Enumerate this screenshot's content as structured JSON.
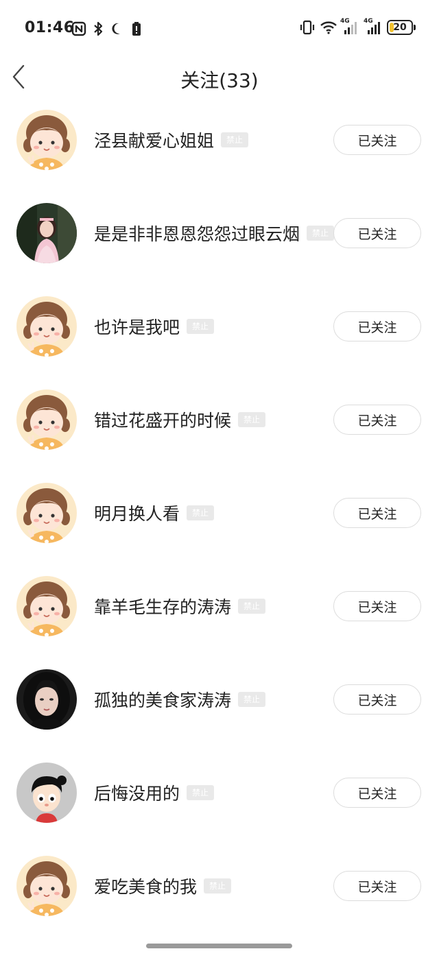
{
  "status_bar": {
    "time": "01:46",
    "battery": "20",
    "net_label_1": "4G",
    "net_label_2": "4G",
    "battery_level": 0.2,
    "left_icons": [
      "nfc-icon",
      "bluetooth-icon",
      "moon-icon",
      "battery-saver-icon"
    ],
    "right_icons": [
      "vibrate-icon",
      "wifi-icon",
      "signal-icon",
      "signal-icon",
      "battery-icon"
    ]
  },
  "header": {
    "title": "关注(33)",
    "back_icon": "chevron-left-icon"
  },
  "follow_label": "已关注",
  "ban_label": "禁止",
  "users": [
    {
      "name": "泾县献爱心姐姐",
      "avatar": "cartoon-girl"
    },
    {
      "name": "是是非非恩恩怨怨过眼云烟",
      "avatar": "photo-woman-dark"
    },
    {
      "name": "也许是我吧",
      "avatar": "cartoon-girl"
    },
    {
      "name": "错过花盛开的时候",
      "avatar": "cartoon-girl"
    },
    {
      "name": "明月换人看",
      "avatar": "cartoon-girl"
    },
    {
      "name": "靠羊毛生存的涛涛",
      "avatar": "cartoon-girl"
    },
    {
      "name": "孤独的美食家涛涛",
      "avatar": "photo-woman-portrait"
    },
    {
      "name": "后悔没用的",
      "avatar": "cartoon-boy"
    },
    {
      "name": "爱吃美食的我",
      "avatar": "cartoon-girl"
    }
  ],
  "colors": {
    "avatar_bg": "#fbe9c8",
    "hair": "#8a5a3c",
    "ban_tag_bg": "#e9e9e9",
    "button_border": "#dcdcdc",
    "battery_fill": "#f2c230"
  }
}
